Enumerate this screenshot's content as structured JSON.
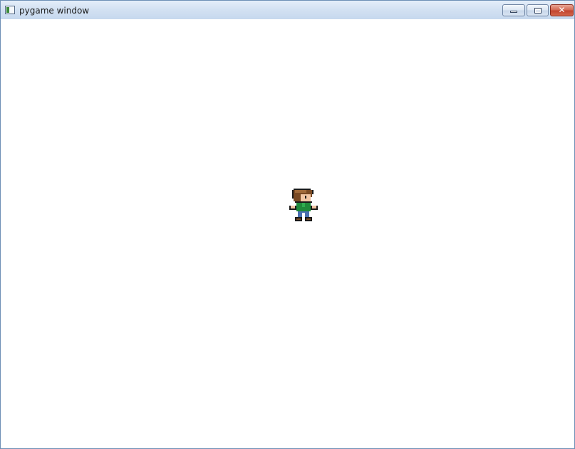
{
  "window": {
    "title": "pygame window",
    "icon": "pygame-app-icon",
    "controls": {
      "minimize_icon": "minimize-icon",
      "maximize_icon": "maximize-icon",
      "close_icon": "close-icon",
      "close_glyph": "✕"
    }
  },
  "game": {
    "background_color": "#ffffff",
    "sprite": {
      "name": "player-character",
      "colors": {
        "hair": "#7a4a24",
        "hair_light": "#a06a3a",
        "skin": "#f2c6a4",
        "shirt": "#1f8a3a",
        "pants": "#4a6fb0",
        "outline": "#1a1a1a"
      }
    }
  }
}
